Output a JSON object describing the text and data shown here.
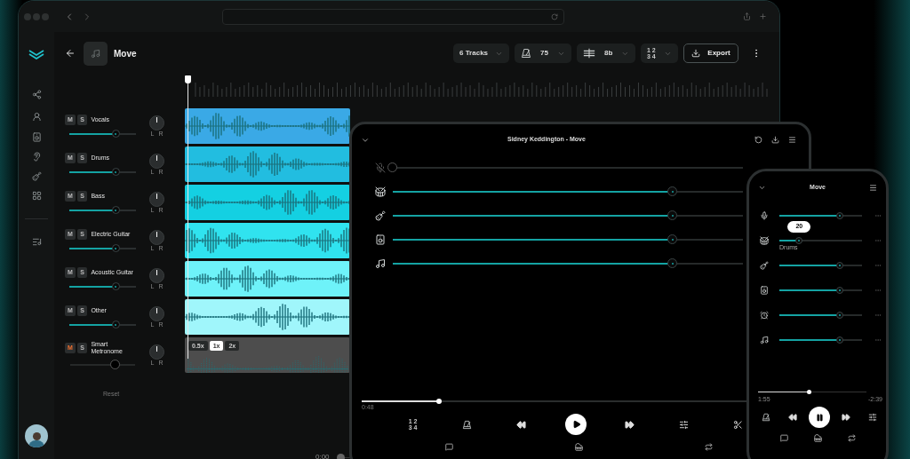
{
  "app": {
    "title": "Move",
    "toolbar": {
      "tracks": "6 Tracks",
      "tempo": "75",
      "key": "8b",
      "time_signature": {
        "top": "1 2",
        "bottom": "3 4"
      },
      "export": "Export"
    },
    "tracks": [
      {
        "kind": "audio",
        "name": "Vocals",
        "mute": "M",
        "solo": "S",
        "muted": false,
        "soloed": false,
        "level": 0.7,
        "pan_left": "L",
        "pan_right": "R",
        "color": "#3aa9e6"
      },
      {
        "kind": "audio",
        "name": "Drums",
        "mute": "M",
        "solo": "S",
        "muted": false,
        "soloed": false,
        "level": 0.7,
        "pan_left": "L",
        "pan_right": "R",
        "color": "#22bde0"
      },
      {
        "kind": "audio",
        "name": "Bass",
        "mute": "M",
        "solo": "S",
        "muted": false,
        "soloed": false,
        "level": 0.7,
        "pan_left": "L",
        "pan_right": "R",
        "color": "#14d0e2"
      },
      {
        "kind": "audio",
        "name": "Electric Guitar",
        "mute": "M",
        "solo": "S",
        "muted": false,
        "soloed": false,
        "level": 0.7,
        "pan_left": "L",
        "pan_right": "R",
        "color": "#30e3ef"
      },
      {
        "kind": "audio",
        "name": "Acoustic Guitar",
        "mute": "M",
        "solo": "S",
        "muted": false,
        "soloed": false,
        "level": 0.7,
        "pan_left": "L",
        "pan_right": "R",
        "color": "#6ef2f9"
      },
      {
        "kind": "audio",
        "name": "Other",
        "mute": "M",
        "solo": "S",
        "muted": false,
        "soloed": false,
        "level": 0.7,
        "pan_left": "L",
        "pan_right": "R",
        "color": "#a0f6fb"
      },
      {
        "kind": "metronome",
        "name": "Smart Metronome",
        "mute": "M",
        "solo": "S",
        "muted": true,
        "soloed": false,
        "level": 0.7,
        "pan_left": "L",
        "pan_right": "R",
        "color": "#4d4d4d",
        "speeds": [
          {
            "label": "0.5x",
            "selected": false
          },
          {
            "label": "1x",
            "selected": true
          },
          {
            "label": "2x",
            "selected": false
          }
        ]
      }
    ],
    "reset": "Reset",
    "time": "0:00",
    "scrubber": {
      "level": 0
    }
  },
  "tablet": {
    "title": "Sidney Keddington - Move",
    "stems": [
      {
        "kind": "vocals",
        "muted": true,
        "level": 0
      },
      {
        "kind": "drums",
        "muted": false,
        "level": 0.8
      },
      {
        "kind": "guitar",
        "muted": false,
        "level": 0.8
      },
      {
        "kind": "bass",
        "muted": false,
        "level": 0.8
      },
      {
        "kind": "other",
        "muted": false,
        "level": 0.8
      }
    ],
    "progress": {
      "level": 0.2
    },
    "elapsed": "0:48",
    "playing": false,
    "time_signature": {
      "top": "1 2",
      "bottom": "3 4"
    }
  },
  "phone": {
    "title": "Move",
    "stems": [
      {
        "kind": "vocals",
        "level": 0.73
      },
      {
        "kind": "drums",
        "level": 0.24,
        "tooltip": "20",
        "label": "Drums"
      },
      {
        "kind": "guitar",
        "level": 0.73
      },
      {
        "kind": "bass",
        "level": 0.73
      },
      {
        "kind": "keys",
        "level": 0.73
      },
      {
        "kind": "other",
        "level": 0.73
      }
    ],
    "progress": {
      "level": 0.47
    },
    "elapsed": "1:55",
    "remaining": "-2:39",
    "playing": true
  }
}
